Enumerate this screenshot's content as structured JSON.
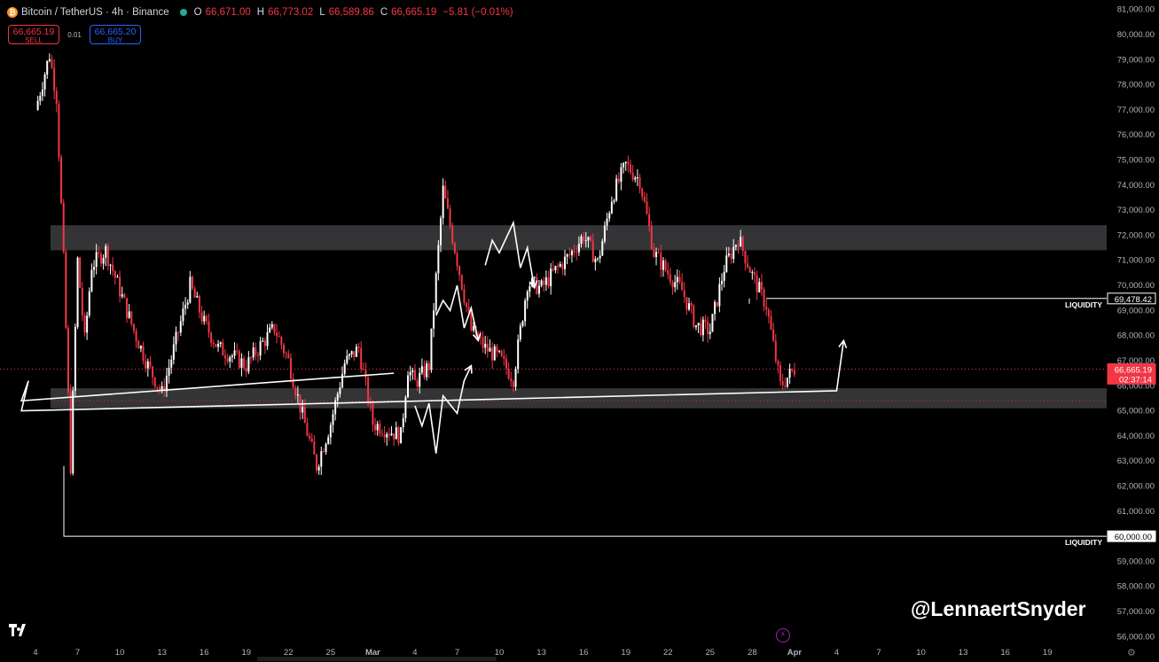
{
  "header": {
    "coin_symbol": "₿",
    "symbol_line": "Bitcoin / TetherUS · 4h · Binance",
    "o_label": "O",
    "o": "66,671.00",
    "h_label": "H",
    "h": "66,773.02",
    "l_label": "L",
    "l": "66,589.86",
    "c_label": "C",
    "c": "66,665.19",
    "change": "−5.81 (−0.01%)"
  },
  "trade": {
    "sell_price": "66,665.19",
    "sell_label": "SELL",
    "spread": "0.01",
    "buy_price": "66,665.20",
    "buy_label": "BUY"
  },
  "watermark": "@LennaertSnyder",
  "colors": {
    "up": "#ffffff",
    "down": "#f23645",
    "zone": "#3a3a3c",
    "background": "#000000"
  },
  "chart_data": {
    "type": "candlestick",
    "timeframe": "4h",
    "ylim": [
      55800,
      81200
    ],
    "y_ticks": [
      56000,
      57000,
      58000,
      59000,
      60000,
      61000,
      62000,
      63000,
      64000,
      65000,
      66000,
      67000,
      68000,
      69000,
      70000,
      71000,
      72000,
      73000,
      74000,
      75000,
      76000,
      77000,
      78000,
      79000,
      80000,
      81000
    ],
    "x_labels": [
      "4",
      "7",
      "10",
      "13",
      "16",
      "19",
      "22",
      "25",
      "Mar",
      "4",
      "7",
      "10",
      "13",
      "16",
      "19",
      "22",
      "25",
      "28",
      "Apr",
      "4",
      "7",
      "10",
      "13",
      "16",
      "19"
    ],
    "current_price": "66,665.19",
    "countdown": "02:37:14",
    "price_path": [
      [
        "4",
        77000
      ],
      [
        "5",
        79200
      ],
      [
        "5.5",
        77500
      ],
      [
        "6",
        71000
      ],
      [
        "6.5",
        62800
      ],
      [
        "7",
        71000
      ],
      [
        "7.5",
        67800
      ],
      [
        "8",
        70800
      ],
      [
        "9",
        71400
      ],
      [
        "10",
        69800
      ],
      [
        "11",
        68200
      ],
      [
        "12",
        66800
      ],
      [
        "13",
        65700
      ],
      [
        "14",
        67800
      ],
      [
        "15",
        70000
      ],
      [
        "16",
        68500
      ],
      [
        "17",
        67500
      ],
      [
        "18",
        67200
      ],
      [
        "19",
        66800
      ],
      [
        "20",
        67600
      ],
      [
        "21",
        68300
      ],
      [
        "22",
        67000
      ],
      [
        "23",
        64800
      ],
      [
        "24",
        62800
      ],
      [
        "25",
        64500
      ],
      [
        "26",
        66900
      ],
      [
        "27",
        67500
      ],
      [
        "28",
        64500
      ],
      [
        "Mar",
        64000
      ],
      [
        "1.5",
        66700
      ],
      [
        "2",
        66100
      ],
      [
        "3",
        66800
      ],
      [
        "4",
        73800
      ],
      [
        "5",
        71000
      ],
      [
        "6",
        68200
      ],
      [
        "7",
        67500
      ],
      [
        "8",
        67100
      ],
      [
        "9",
        66300
      ],
      [
        "10",
        70100
      ],
      [
        "11",
        69900
      ],
      [
        "12",
        70600
      ],
      [
        "13",
        71200
      ],
      [
        "14",
        72000
      ],
      [
        "15",
        70900
      ],
      [
        "16",
        73500
      ],
      [
        "17",
        74800
      ],
      [
        "18",
        74200
      ],
      [
        "19",
        71300
      ],
      [
        "20",
        70500
      ],
      [
        "21",
        69800
      ],
      [
        "22",
        68400
      ],
      [
        "23",
        68200
      ],
      [
        "24",
        70700
      ],
      [
        "25",
        71900
      ],
      [
        "26",
        70400
      ],
      [
        "27",
        69200
      ],
      [
        "28",
        66000
      ],
      [
        "29",
        66665
      ]
    ],
    "zones": [
      {
        "from": 71400,
        "to": 72400
      },
      {
        "from": 65100,
        "to": 65900
      }
    ],
    "liquidity_levels": [
      {
        "price": 69478.42,
        "label": "LIQUIDITY",
        "price_label": "69,478.42"
      },
      {
        "price": 60000,
        "label": "LIQUIDITY",
        "price_label": "60,000.00"
      }
    ],
    "projection_paths": [
      [
        [
          "29.5",
          66500
        ],
        [
          "30",
          65400
        ],
        [
          "30.5",
          66200
        ],
        [
          "31",
          65000
        ],
        [
          "Apr",
          65800
        ],
        [
          "1.5",
          67800
        ]
      ],
      [
        [
          "2",
          65200
        ],
        [
          "2.5",
          64400
        ],
        [
          "3",
          65300
        ],
        [
          "3.5",
          63300
        ],
        [
          "4",
          65600
        ],
        [
          "5",
          64900
        ],
        [
          "5.5",
          66200
        ],
        [
          "6",
          66800
        ]
      ],
      [
        [
          "3.5",
          68800
        ],
        [
          "4",
          69400
        ],
        [
          "4.5",
          69000
        ],
        [
          "5",
          70000
        ],
        [
          "5.5",
          68300
        ],
        [
          "6",
          69100
        ],
        [
          "6.5",
          67800
        ]
      ],
      [
        [
          "7",
          70800
        ],
        [
          "7.5",
          71800
        ],
        [
          "8",
          71300
        ],
        [
          "9",
          72500
        ],
        [
          "9.5",
          70700
        ],
        [
          "10",
          71500
        ],
        [
          "10.5",
          69900
        ]
      ]
    ]
  }
}
